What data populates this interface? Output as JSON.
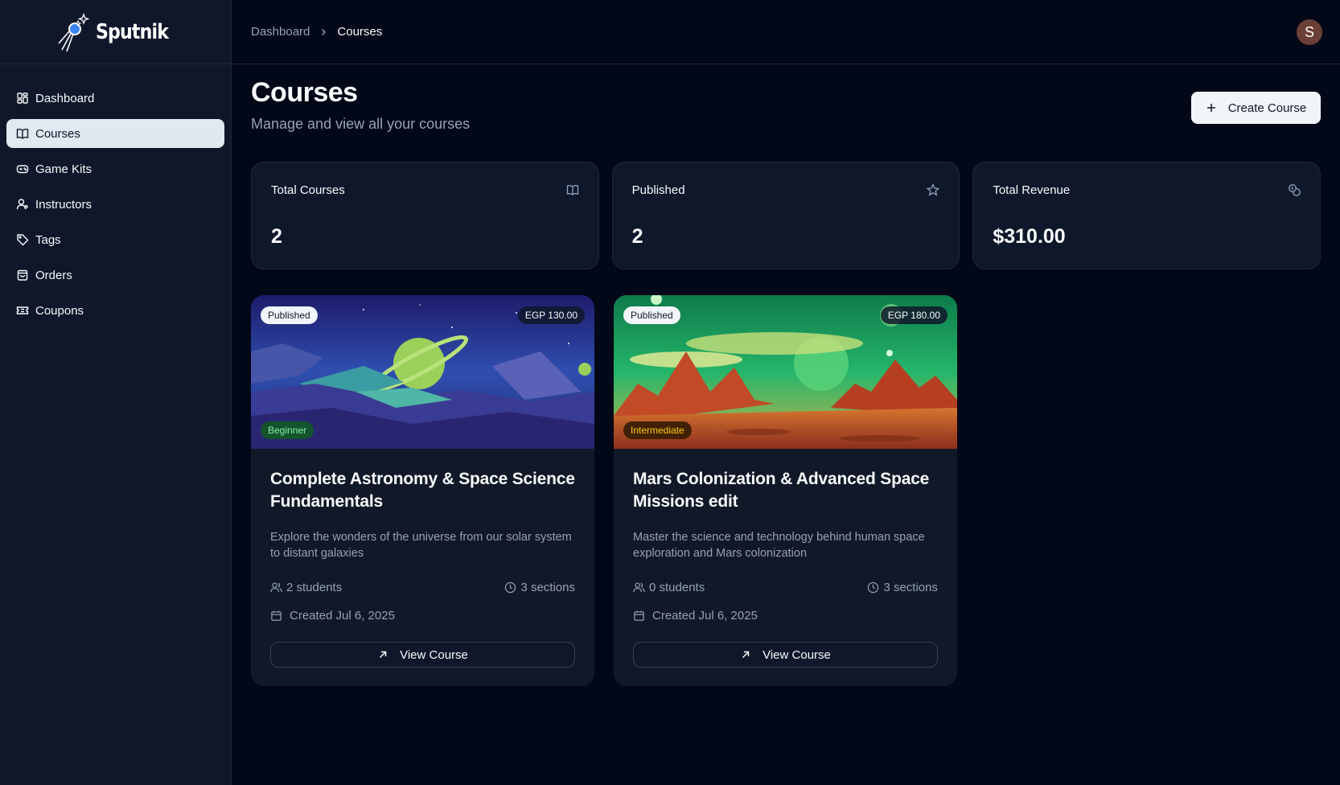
{
  "app": {
    "logo_text": "Sputnik"
  },
  "sidebar": {
    "items": [
      {
        "label": "Dashboard",
        "icon": "dashboard-icon"
      },
      {
        "label": "Courses",
        "icon": "book-icon",
        "active": true
      },
      {
        "label": "Game Kits",
        "icon": "gamepad-icon"
      },
      {
        "label": "Instructors",
        "icon": "user-icon"
      },
      {
        "label": "Tags",
        "icon": "tag-icon"
      },
      {
        "label": "Orders",
        "icon": "shopping-bag-icon"
      },
      {
        "label": "Coupons",
        "icon": "ticket-icon"
      }
    ]
  },
  "header": {
    "breadcrumb": [
      "Dashboard",
      "Courses"
    ],
    "avatar_initial": "S"
  },
  "page": {
    "title": "Courses",
    "subtitle": "Manage and view all your courses",
    "create_label": "Create Course"
  },
  "stats": [
    {
      "label": "Total Courses",
      "value": "2",
      "icon": "book-icon"
    },
    {
      "label": "Published",
      "value": "2",
      "icon": "star-icon"
    },
    {
      "label": "Total Revenue",
      "value": "$310.00",
      "icon": "coins-icon"
    }
  ],
  "courses": [
    {
      "status": "Published",
      "price": "EGP 130.00",
      "level": "Beginner",
      "title": "Complete Astronomy & Space Science Fundamentals",
      "description": "Explore the wonders of the universe from our solar system to distant galaxies",
      "students": "2 students",
      "sections": "3 sections",
      "created": "Created Jul 6, 2025",
      "button": "View Course"
    },
    {
      "status": "Published",
      "price": "EGP 180.00",
      "level": "Intermediate",
      "title": "Mars Colonization & Advanced Space Missions edit",
      "description": "Master the science and technology behind human space exploration and Mars colonization",
      "students": "0 students",
      "sections": "3 sections",
      "created": "Created Jul 6, 2025",
      "button": "View Course"
    }
  ],
  "colors": {
    "background": "#020817",
    "sidebar": "#0f172a",
    "active_nav": "#e2e8f0",
    "avatar": "#6b3f36",
    "beginner_badge": "#14532d",
    "intermediate_badge": "#422006"
  }
}
